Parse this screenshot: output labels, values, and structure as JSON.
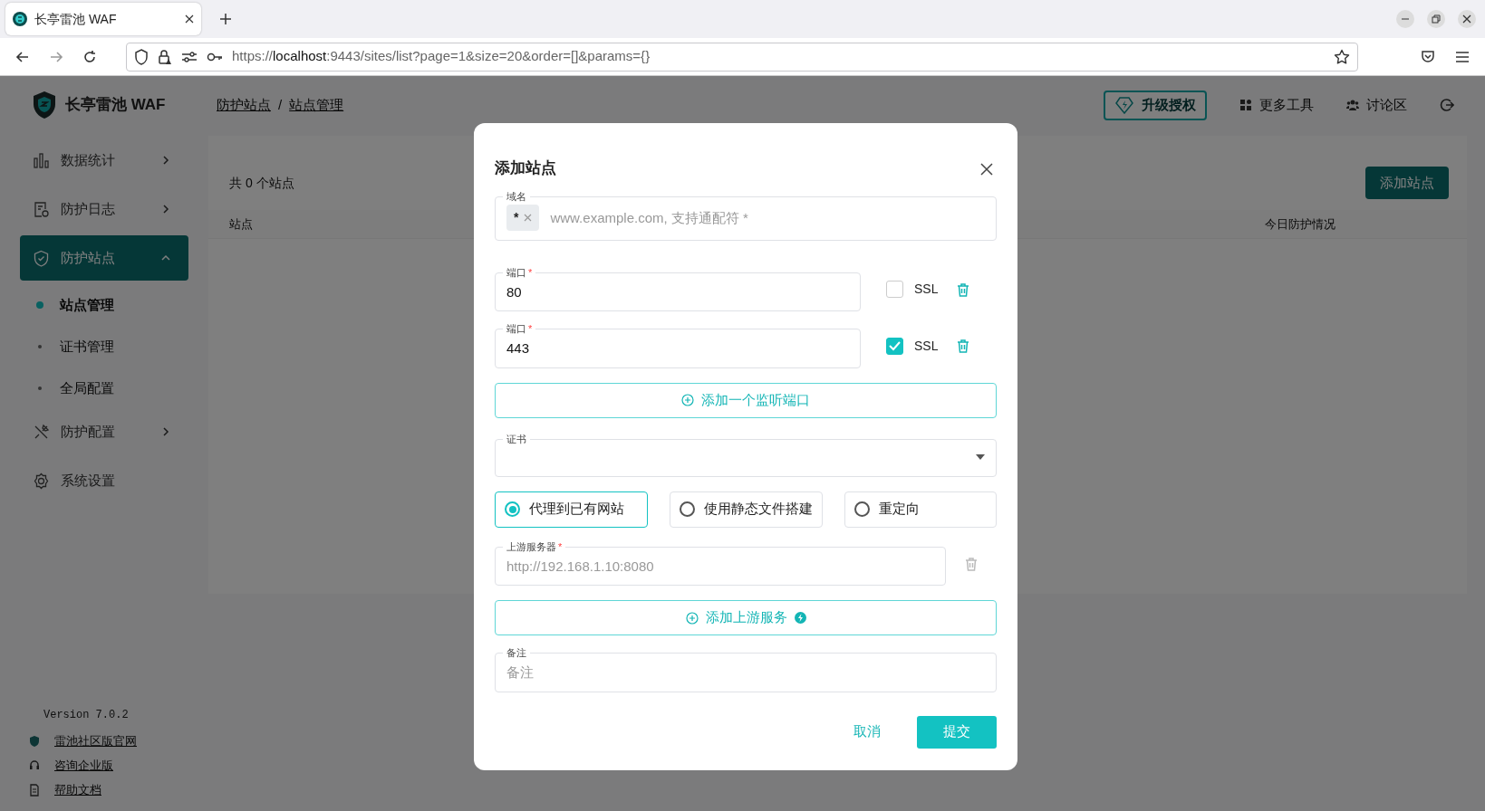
{
  "browser": {
    "tab_title": "长亭雷池 WAF",
    "url_scheme": "https://",
    "url_host": "localhost",
    "url_rest": ":9443/sites/list?page=1&size=20&order=[]&params={}"
  },
  "sidebar": {
    "brand": "长亭雷池 WAF",
    "items": [
      {
        "label": "数据统计",
        "kind": "group",
        "expanded": false,
        "selected": false
      },
      {
        "label": "防护日志",
        "kind": "group",
        "expanded": false,
        "selected": false
      },
      {
        "label": "防护站点",
        "kind": "group",
        "expanded": true,
        "selected": true,
        "children": [
          {
            "label": "站点管理",
            "selected": true
          },
          {
            "label": "证书管理",
            "selected": false
          },
          {
            "label": "全局配置",
            "selected": false
          }
        ]
      },
      {
        "label": "防护配置",
        "kind": "group",
        "expanded": false,
        "selected": false
      },
      {
        "label": "系统设置",
        "kind": "link",
        "selected": false
      }
    ],
    "version": "Version 7.0.2",
    "links": [
      "雷池社区版官网",
      "咨询企业版",
      "帮助文档"
    ]
  },
  "header": {
    "breadcrumb": [
      "防护站点",
      "站点管理"
    ],
    "breadcrumb_separator": "/",
    "actions": [
      {
        "label": "升级授权",
        "kind": "outline"
      },
      {
        "label": "更多工具",
        "kind": "text"
      },
      {
        "label": "讨论区",
        "kind": "text"
      }
    ]
  },
  "content": {
    "count": "共 0 个站点",
    "add_button": "添加站点",
    "columns": [
      "站点",
      "今日防护情况"
    ]
  },
  "dialog": {
    "title": "添加站点",
    "domain": {
      "label": "域名",
      "tags": [
        "*"
      ],
      "placeholder": "www.example.com, 支持通配符 *"
    },
    "ports": [
      {
        "label": "端口",
        "required_mark": "*",
        "value": "80",
        "ssl_label": "SSL",
        "ssl_checked": false
      },
      {
        "label": "端口",
        "required_mark": "*",
        "value": "443",
        "ssl_label": "SSL",
        "ssl_checked": true
      }
    ],
    "add_port_button": "添加一个监听端口",
    "cert": {
      "label": "证书"
    },
    "modes": [
      {
        "label": "代理到已有网站",
        "selected": true
      },
      {
        "label": "使用静态文件搭建",
        "selected": false
      },
      {
        "label": "重定向",
        "selected": false
      }
    ],
    "upstreams": [
      {
        "label": "上游服务器",
        "required_mark": "*",
        "placeholder": "http://192.168.1.10:8080",
        "delete_disabled": true
      }
    ],
    "add_upstream_button": "添加上游服务",
    "remark": {
      "label": "备注",
      "placeholder": "备注"
    },
    "cancel": "取消",
    "submit": "提交"
  }
}
